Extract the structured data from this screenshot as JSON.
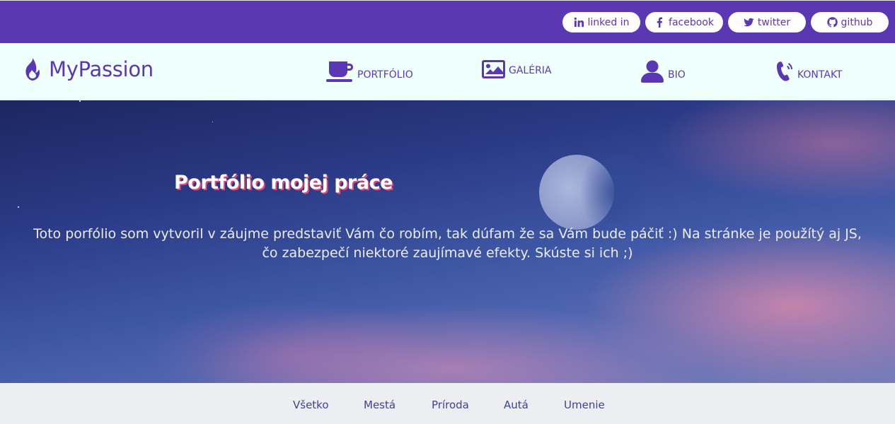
{
  "social": {
    "linkedin": {
      "label": "linked in",
      "icon": "linkedin-icon"
    },
    "facebook": {
      "label": "facebook",
      "icon": "facebook-icon"
    },
    "twitter": {
      "label": "twitter",
      "icon": "twitter-icon"
    },
    "github": {
      "label": "github",
      "icon": "github-icon"
    }
  },
  "brand": {
    "name": "MyPassion",
    "icon": "flame-icon"
  },
  "nav": {
    "portfolio": {
      "label": "PORTFÓLIO",
      "icon": "coffee-cup-icon"
    },
    "gallery": {
      "label": "GALÉRIA",
      "icon": "image-icon"
    },
    "bio": {
      "label": "BIO",
      "icon": "user-icon"
    },
    "contact": {
      "label": "KONTAKT",
      "icon": "phone-volume-icon"
    }
  },
  "hero": {
    "title": "Portfólio mojej práce",
    "text": "Toto porfólio som vytvoril v záujme predstaviť Vám čo robím, tak dúfam že sa Vám bude páčiť :) Na stránke je použítý aj JS, čo zabezpečí niektoré zaujímavé efekty. Skúste si ich ;)"
  },
  "filters": {
    "all": "Všetko",
    "cities": "Mestá",
    "nature": "Príroda",
    "cars": "Autá",
    "art": "Umenie"
  },
  "colors": {
    "primary": "#5b38b3",
    "nav_bg": "#effffe",
    "filter_text": "#3d3f9e",
    "title_shadow": "#e04a7a"
  }
}
